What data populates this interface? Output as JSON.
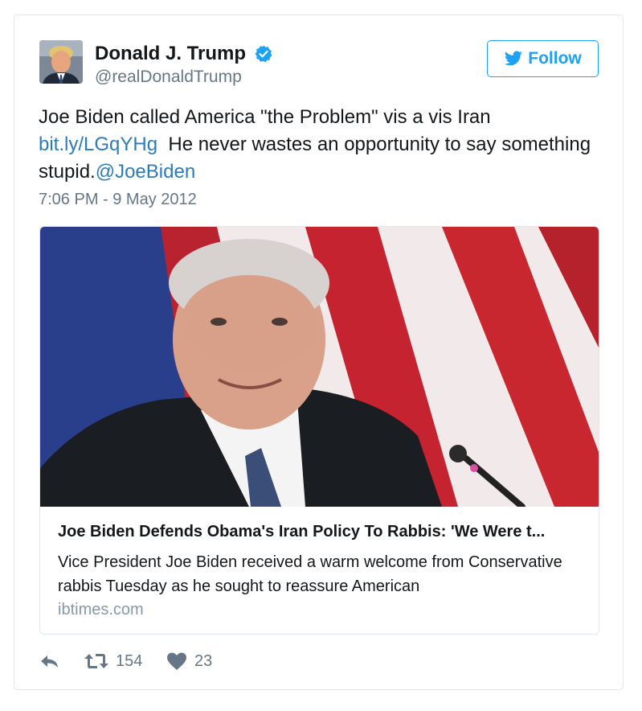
{
  "user": {
    "name": "Donald J. Trump",
    "handle": "@realDonaldTrump",
    "verified": true
  },
  "follow_button": {
    "label": "Follow",
    "icon": "twitter-bird-icon"
  },
  "tweet": {
    "text_1": "Joe Biden called America \"the Problem\" vis a vis Iran",
    "link": "bit.ly/LGqYHg",
    "text_2": "He never wastes an opportunity to say something stupid.",
    "mention": "@JoeBiden",
    "timestamp": "7:06 PM - 9 May 2012"
  },
  "card": {
    "title": "Joe Biden Defends Obama's Iran Policy To Rabbis: 'We Were t...",
    "description": "Vice President Joe Biden received a warm welcome from Conservative rabbis Tuesday as he sought to reassure American",
    "domain": "ibtimes.com"
  },
  "actions": {
    "reply_icon": "reply-icon",
    "retweet_icon": "retweet-icon",
    "retweets": "154",
    "like_icon": "heart-icon",
    "likes": "23"
  },
  "colors": {
    "accent": "#1da1f2",
    "link": "#2b7bb9",
    "muted": "#657786",
    "border": "#e1e8ed"
  }
}
